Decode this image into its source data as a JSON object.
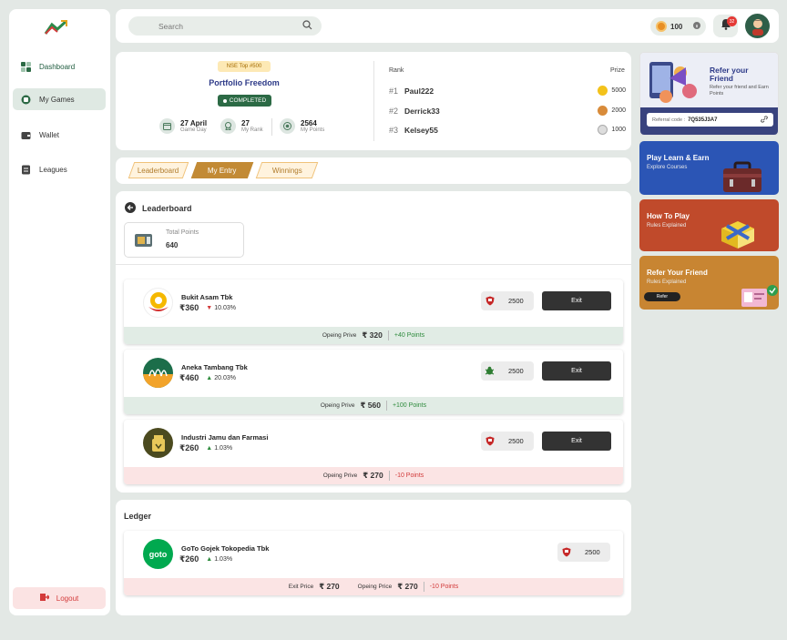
{
  "sidebar": {
    "items": [
      {
        "label": "Dashboard"
      },
      {
        "label": "My Games"
      },
      {
        "label": "Wallet"
      },
      {
        "label": "Leagues"
      }
    ],
    "logout": "Logout"
  },
  "topbar": {
    "search_placeholder": "Search",
    "coins": "100",
    "notifications": "32"
  },
  "portfolio": {
    "tag": "NSE Top #500",
    "title": "Portfolio Freedom",
    "status": "COMPLETED",
    "stats": [
      {
        "value": "27 April",
        "label": "Game Day"
      },
      {
        "value": "27",
        "label": "My Rank"
      },
      {
        "value": "2564",
        "label": "My Points"
      }
    ],
    "rank_header": "Rank",
    "prize_header": "Prize",
    "ranks": [
      {
        "rank": "#1",
        "name": "Paul222",
        "prize": "5000",
        "medal_color": "#f3c21b"
      },
      {
        "rank": "#2",
        "name": "Derrick33",
        "prize": "2000",
        "medal_color": "#d88b3a"
      },
      {
        "rank": "#3",
        "name": "Kelsey55",
        "prize": "1000",
        "medal_color": "#c9c9c9"
      }
    ]
  },
  "tabs": [
    {
      "label": "Leaderboard"
    },
    {
      "label": "My Entry"
    },
    {
      "label": "Winnings"
    }
  ],
  "leaderboard": {
    "title": "Leaderboard",
    "total_points_label": "Total Points",
    "total_points": "640",
    "stocks": [
      {
        "name": "Bukit Asam Tbk",
        "price": "₹360",
        "change": "10.03%",
        "direction": "down",
        "points": "2500",
        "exit_label": "Exit",
        "foot_label": "Opeing Prive",
        "foot_price": "₹ 320",
        "foot_points": "+40 Points",
        "foot_tone": "green"
      },
      {
        "name": "Aneka Tambang Tbk",
        "price": "₹460",
        "change": "20.03%",
        "direction": "up",
        "points": "2500",
        "exit_label": "Exit",
        "foot_label": "Opeing Prive",
        "foot_price": "₹ 560",
        "foot_points": "+100 Points",
        "foot_tone": "green"
      },
      {
        "name": "Industri Jamu dan Farmasi",
        "price": "₹260",
        "change": "1.03%",
        "direction": "up",
        "points": "2500",
        "exit_label": "Exit",
        "foot_label": "Opeing Prive",
        "foot_price": "₹ 270",
        "foot_points": "-10 Points",
        "foot_tone": "red"
      }
    ]
  },
  "ledger": {
    "title": "Ledger",
    "item": {
      "name": "GoTo Gojek Tokopedia Tbk",
      "logo_text": "goto",
      "price": "₹260",
      "change": "1.03%",
      "points": "2500",
      "exit_label": "Exit Price",
      "exit_price": "₹ 270",
      "open_label": "Opeing Price",
      "open_price": "₹ 270",
      "foot_points": "-10 Points"
    }
  },
  "promos": {
    "refer": {
      "title_line1": "Refer your",
      "title_line2": "Friend",
      "sub": "Refer your friend and Earn Points",
      "code_label": "Referral code :",
      "code": "7Q535J3A7"
    },
    "learn": {
      "title": "Play Learn  & Earn",
      "sub": "Explore Courses"
    },
    "howto": {
      "title": "How To Play",
      "sub": "Rules Explained"
    },
    "refer2": {
      "title": "Refer Your Friend",
      "sub": "Rules Explained",
      "button": "Refer"
    }
  },
  "colors": {
    "brand_green": "#2c6a45",
    "accent_gold": "#c28a35",
    "navy": "#2d3a88"
  }
}
